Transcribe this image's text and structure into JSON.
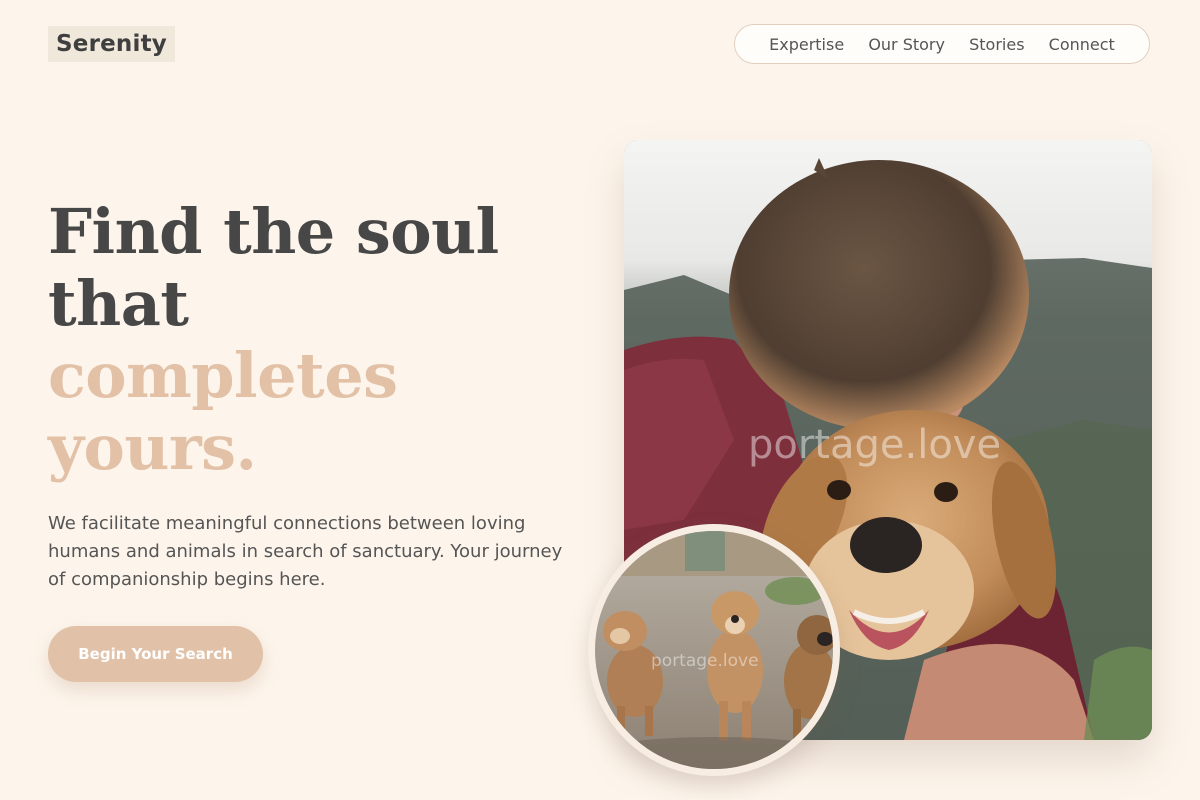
{
  "brand": {
    "name": "Serenity"
  },
  "nav": {
    "items": [
      {
        "label": "Expertise"
      },
      {
        "label": "Our Story"
      },
      {
        "label": "Stories"
      },
      {
        "label": "Connect"
      }
    ]
  },
  "hero": {
    "headline_line1": "Find the soul",
    "headline_line2": "that",
    "headline_line3": "completes",
    "headline_line4": "yours.",
    "description": "We facilitate meaningful connections between loving humans and animals in search of sanctuary. Your journey of companionship begins here.",
    "cta_label": "Begin Your Search"
  },
  "images": {
    "main_watermark": "portage.love",
    "circle_watermark": "portage.love"
  },
  "colors": {
    "background": "#fdf5ec",
    "accent": "#e1c2a8",
    "text_dark": "#474747"
  }
}
